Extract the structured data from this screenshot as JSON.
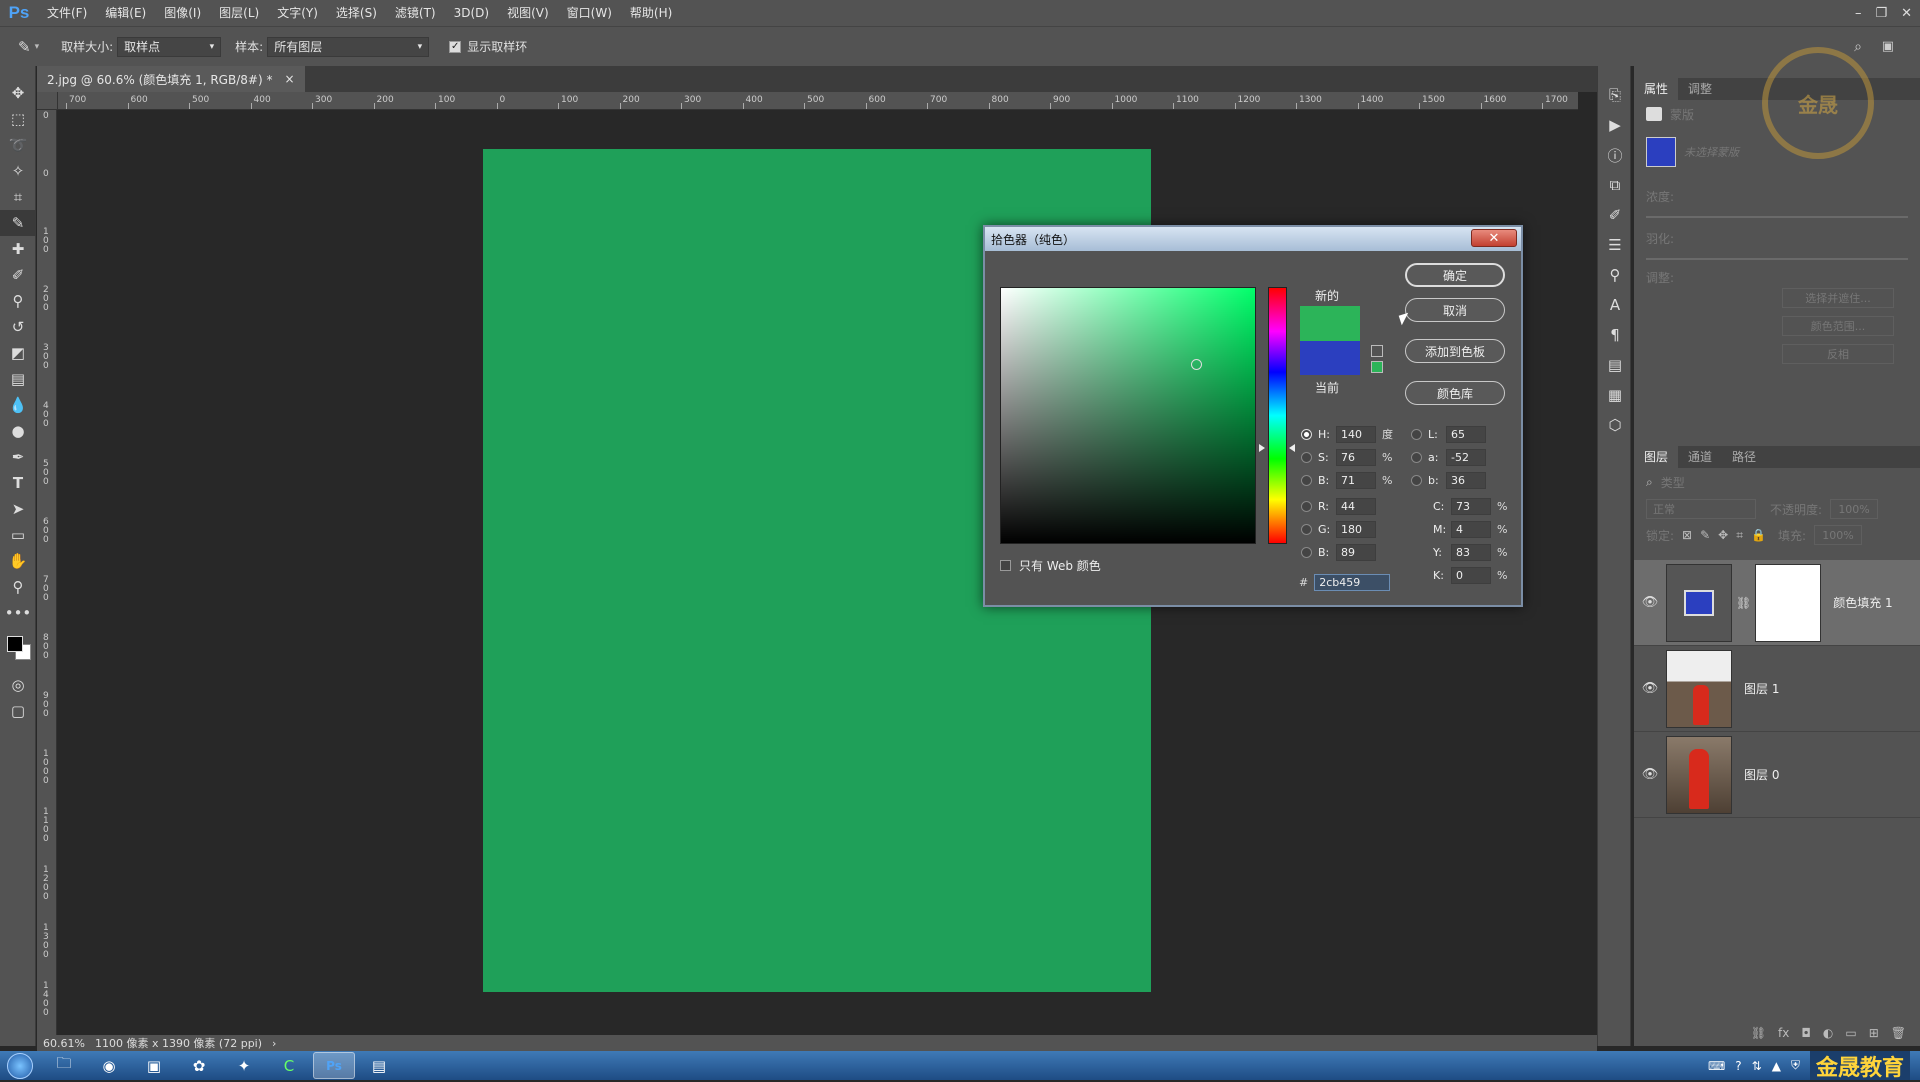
{
  "app": {
    "logo": "Ps"
  },
  "menu": [
    "文件(F)",
    "编辑(E)",
    "图像(I)",
    "图层(L)",
    "文字(Y)",
    "选择(S)",
    "滤镜(T)",
    "3D(D)",
    "视图(V)",
    "窗口(W)",
    "帮助(H)"
  ],
  "window_controls": {
    "minimize": "–",
    "restore": "❐",
    "close": "✕"
  },
  "options": {
    "sample_size_label": "取样大小:",
    "sample_size_value": "取样点",
    "sample_label": "样本:",
    "sample_value": "所有图层",
    "show_ring_label": "显示取样环",
    "show_ring_checked": true
  },
  "document_tab": {
    "title": "2.jpg @ 60.6% (颜色填充 1, RGB/8#) *",
    "close": "×"
  },
  "ruler_h": [
    "700",
    "600",
    "500",
    "400",
    "300",
    "200",
    "100",
    "0",
    "100",
    "200",
    "300",
    "400",
    "500",
    "600",
    "700",
    "800",
    "900",
    "1000",
    "1100",
    "1200",
    "1300",
    "1400",
    "1500",
    "1600",
    "1700"
  ],
  "ruler_v": [
    "0",
    "0",
    "100",
    "200",
    "300",
    "400",
    "500",
    "600",
    "700",
    "800",
    "900",
    "1000",
    "1100",
    "1200",
    "1300",
    "1400"
  ],
  "document_color": "#1fa059",
  "status": {
    "zoom": "60.61%",
    "info": "1100 像素 x 1390 像素 (72 ppi)",
    "arrow": "›"
  },
  "color_picker": {
    "title": "拾色器（纯色）",
    "close": "✕",
    "new_label": "新的",
    "current_label": "当前",
    "new_color": "#2cb459",
    "current_color": "#2b3fbf",
    "buttons": {
      "ok": "确定",
      "cancel": "取消",
      "add_swatch": "添加到色板",
      "libraries": "颜色库"
    },
    "web_only_label": "只有 Web 颜色",
    "hsb": {
      "H": "140",
      "S": "76",
      "B": "71",
      "H_unit": "度",
      "S_unit": "%",
      "B_unit": "%"
    },
    "rgb": {
      "R": "44",
      "G": "180",
      "B": "89"
    },
    "lab": {
      "L": "65",
      "a": "-52",
      "b": "36"
    },
    "cmyk": {
      "C": "73",
      "M": "4",
      "Y": "83",
      "K": "0",
      "unit": "%"
    },
    "field_labels": {
      "H": "H:",
      "S": "S:",
      "Bb": "B:",
      "R": "R:",
      "G": "G:",
      "Brgb": "B:",
      "L": "L:",
      "a": "a:",
      "b": "b:",
      "C": "C:",
      "M": "M:",
      "Y": "Y:",
      "K": "K:"
    },
    "hex_prefix": "#",
    "hex": "2cb459"
  },
  "properties_panel": {
    "tabs": [
      "属性",
      "调整"
    ],
    "mask_label": "蒙版",
    "no_selection": "未选择蒙版",
    "density_label": "浓度:",
    "feather_label": "羽化:",
    "adjust_label": "调整:",
    "select_mask_btn": "选择并遮住...",
    "color_range_btn": "颜色范围...",
    "invert_btn": "反相"
  },
  "layers_panel": {
    "tabs": [
      "图层",
      "通道",
      "路径"
    ],
    "filter_label": "类型",
    "blend_mode": "正常",
    "opacity_label": "不透明度:",
    "opacity_value": "100%",
    "lock_label": "锁定:",
    "fill_label": "填充:",
    "fill_value": "100%",
    "layers": [
      {
        "name": "颜色填充 1",
        "selected": true
      },
      {
        "name": "图层 1",
        "selected": false
      },
      {
        "name": "图层 0",
        "selected": false
      }
    ]
  },
  "taskbar": {
    "brand": "金晟教育"
  },
  "watermark": "金晟"
}
